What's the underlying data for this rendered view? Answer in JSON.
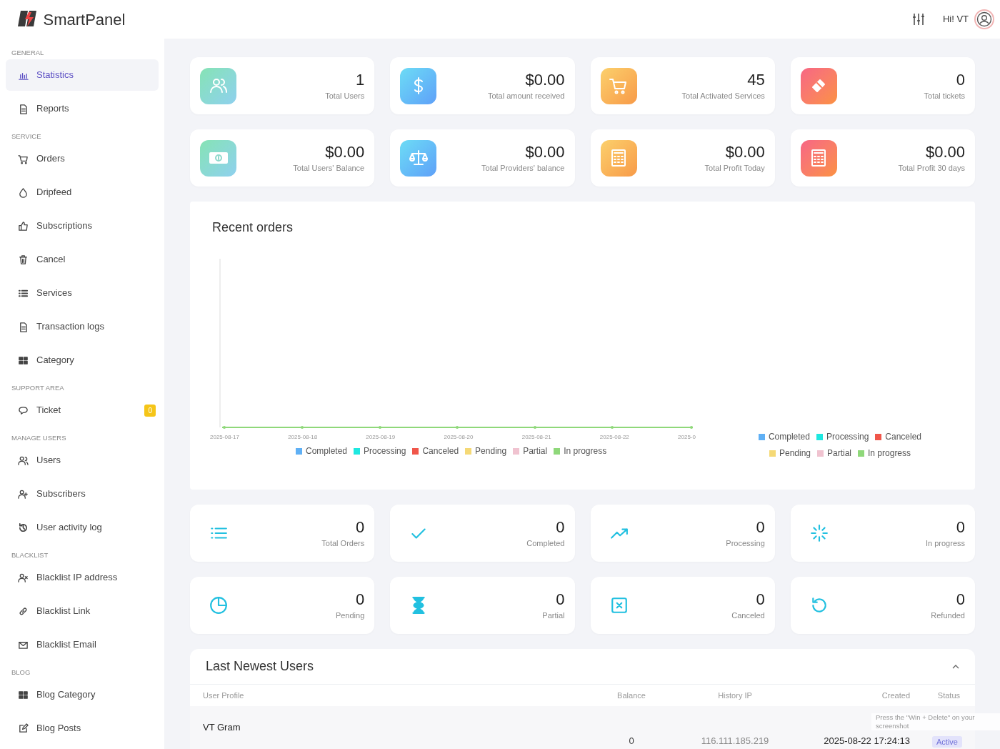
{
  "brand": "SmartPanel",
  "header": {
    "greeting": "Hi! VT"
  },
  "sidebar": [
    {
      "section": "GENERAL",
      "items": [
        {
          "label": "Statistics",
          "selected": true
        },
        {
          "label": "Reports",
          "selected": false
        }
      ]
    },
    {
      "section": "SERVICE",
      "items": [
        {
          "label": "Orders",
          "selected": false
        },
        {
          "label": "Dripfeed",
          "selected": false
        },
        {
          "label": "Subscriptions",
          "selected": false
        },
        {
          "label": "Cancel",
          "selected": false
        },
        {
          "label": "Services",
          "selected": false
        },
        {
          "label": "Transaction logs",
          "selected": false
        },
        {
          "label": "Category",
          "selected": false
        }
      ]
    },
    {
      "section": "SUPPORT AREA",
      "items": [
        {
          "label": "Ticket",
          "selected": false,
          "badge": "0"
        }
      ]
    },
    {
      "section": "MANAGE USERS",
      "items": [
        {
          "label": "Users",
          "selected": false
        },
        {
          "label": "Subscribers",
          "selected": false
        },
        {
          "label": "User activity log",
          "selected": false
        }
      ]
    },
    {
      "section": "BLACKLIST",
      "items": [
        {
          "label": "Blacklist IP address",
          "selected": false
        },
        {
          "label": "Blacklist Link",
          "selected": false
        },
        {
          "label": "Blacklist Email",
          "selected": false
        }
      ]
    },
    {
      "section": "BLOG",
      "items": [
        {
          "label": "Blog Category",
          "selected": false
        },
        {
          "label": "Blog Posts",
          "selected": false
        }
      ]
    }
  ],
  "summary_cards": [
    {
      "value": "1",
      "label": "Total Users"
    },
    {
      "value": "$0.00",
      "label": "Total amount received"
    },
    {
      "value": "45",
      "label": "Total Activated Services"
    },
    {
      "value": "0",
      "label": "Total tickets"
    },
    {
      "value": "$0.00",
      "label": "Total Users' Balance"
    },
    {
      "value": "$0.00",
      "label": "Total Providers' balance"
    },
    {
      "value": "$0.00",
      "label": "Total Profit Today"
    },
    {
      "value": "$0.00",
      "label": "Total Profit 30 days"
    }
  ],
  "recent_orders": {
    "title": "Recent orders",
    "x_labels": [
      "2025-08-17",
      "2025-08-18",
      "2025-08-19",
      "2025-08-20",
      "2025-08-21",
      "2025-08-22",
      "2025-0"
    ],
    "legend": [
      {
        "label": "Completed",
        "color": "#5fb0f5"
      },
      {
        "label": "Processing",
        "color": "#1ee8e0"
      },
      {
        "label": "Canceled",
        "color": "#f0564a"
      },
      {
        "label": "Pending",
        "color": "#f5d976"
      },
      {
        "label": "Partial",
        "color": "#f0c3d0"
      },
      {
        "label": "In progress",
        "color": "#8fd87a"
      }
    ],
    "side_legend": [
      {
        "label": "Completed",
        "color": "#5fb0f5"
      },
      {
        "label": "Processing",
        "color": "#1ee8e0"
      },
      {
        "label": "Canceled",
        "color": "#f0564a"
      },
      {
        "label": "Pending",
        "color": "#f5d976"
      },
      {
        "label": "Partial",
        "color": "#f0c3d0"
      },
      {
        "label": "In progress",
        "color": "#8fd87a"
      }
    ]
  },
  "order_cards": [
    {
      "value": "0",
      "label": "Total Orders"
    },
    {
      "value": "0",
      "label": "Completed"
    },
    {
      "value": "0",
      "label": "Processing"
    },
    {
      "value": "0",
      "label": "In progress"
    },
    {
      "value": "0",
      "label": "Pending"
    },
    {
      "value": "0",
      "label": "Partial"
    },
    {
      "value": "0",
      "label": "Canceled"
    },
    {
      "value": "0",
      "label": "Refunded"
    }
  ],
  "newest_users": {
    "title": "Last Newest Users",
    "columns": [
      "User Profile",
      "Balance",
      "History IP",
      "Created",
      "Status"
    ],
    "rows": [
      {
        "name": "VT Gram",
        "balance": "0",
        "ip": "116.111.185.219",
        "created": "2025-08-22 17:24:13",
        "status": "Active"
      }
    ]
  },
  "hint_toast": {
    "text": "Press the \"Win + Delete\" on your screenshot"
  }
}
